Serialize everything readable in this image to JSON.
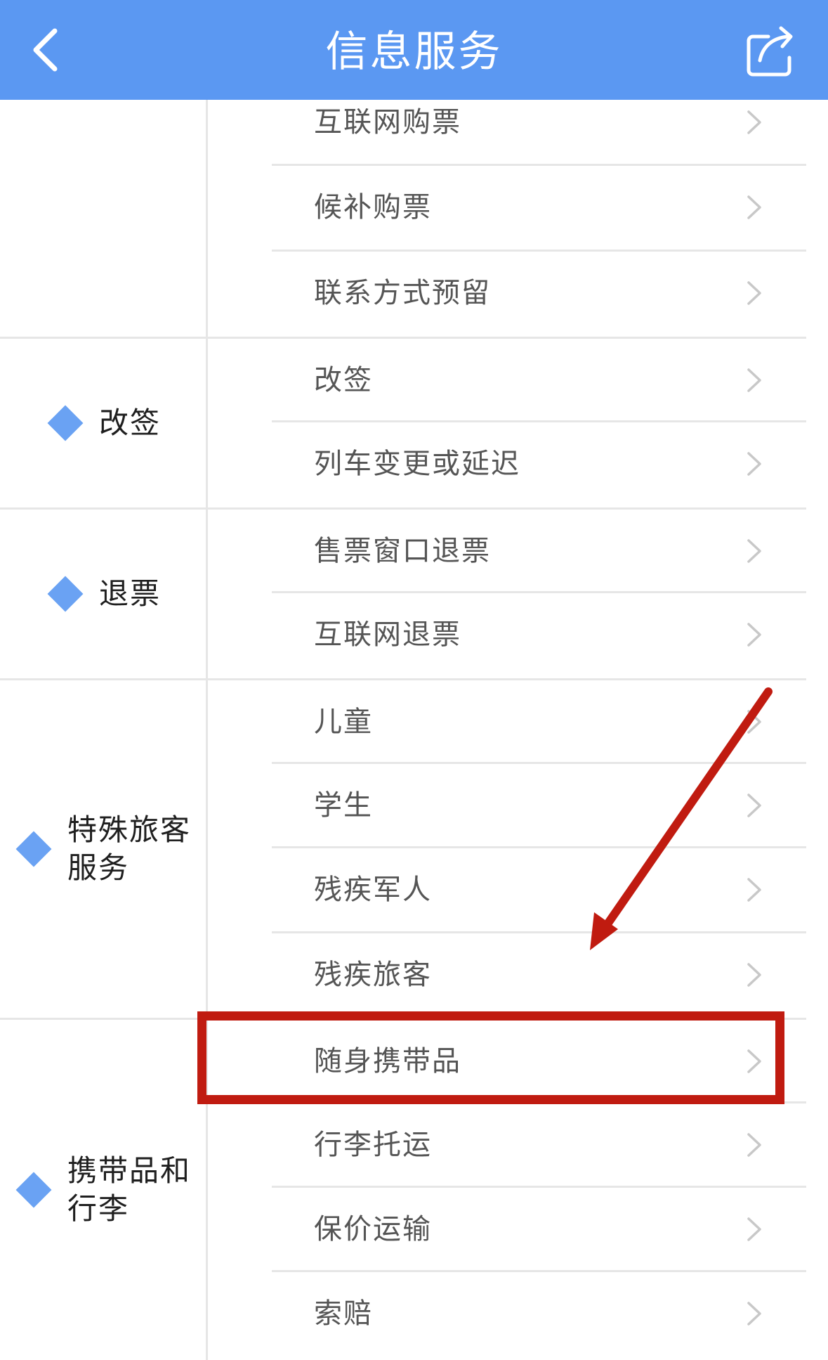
{
  "header": {
    "title": "信息服务",
    "back_icon": "chevron-left-icon",
    "share_icon": "share-icon",
    "bg_color": "#5b98f2"
  },
  "categories": [
    {
      "label": "改签"
    },
    {
      "label": "退票"
    },
    {
      "label": "特殊旅客服务"
    },
    {
      "label": "携带品和行李"
    }
  ],
  "items": [
    {
      "label": "互联网购票"
    },
    {
      "label": "候补购票"
    },
    {
      "label": "联系方式预留"
    },
    {
      "label": "改签"
    },
    {
      "label": "列车变更或延迟"
    },
    {
      "label": "售票窗口退票"
    },
    {
      "label": "互联网退票"
    },
    {
      "label": "儿童"
    },
    {
      "label": "学生"
    },
    {
      "label": "残疾军人"
    },
    {
      "label": "残疾旅客"
    },
    {
      "label": "随身携带品"
    },
    {
      "label": "行李托运"
    },
    {
      "label": "保价运输"
    },
    {
      "label": "索赔"
    }
  ],
  "annotation": {
    "highlighted_item": "随身携带品",
    "color": "#c01b10"
  },
  "colors": {
    "accent": "#5b98f2",
    "diamond": "#6aa2f3",
    "divider": "#e6e6e6"
  }
}
